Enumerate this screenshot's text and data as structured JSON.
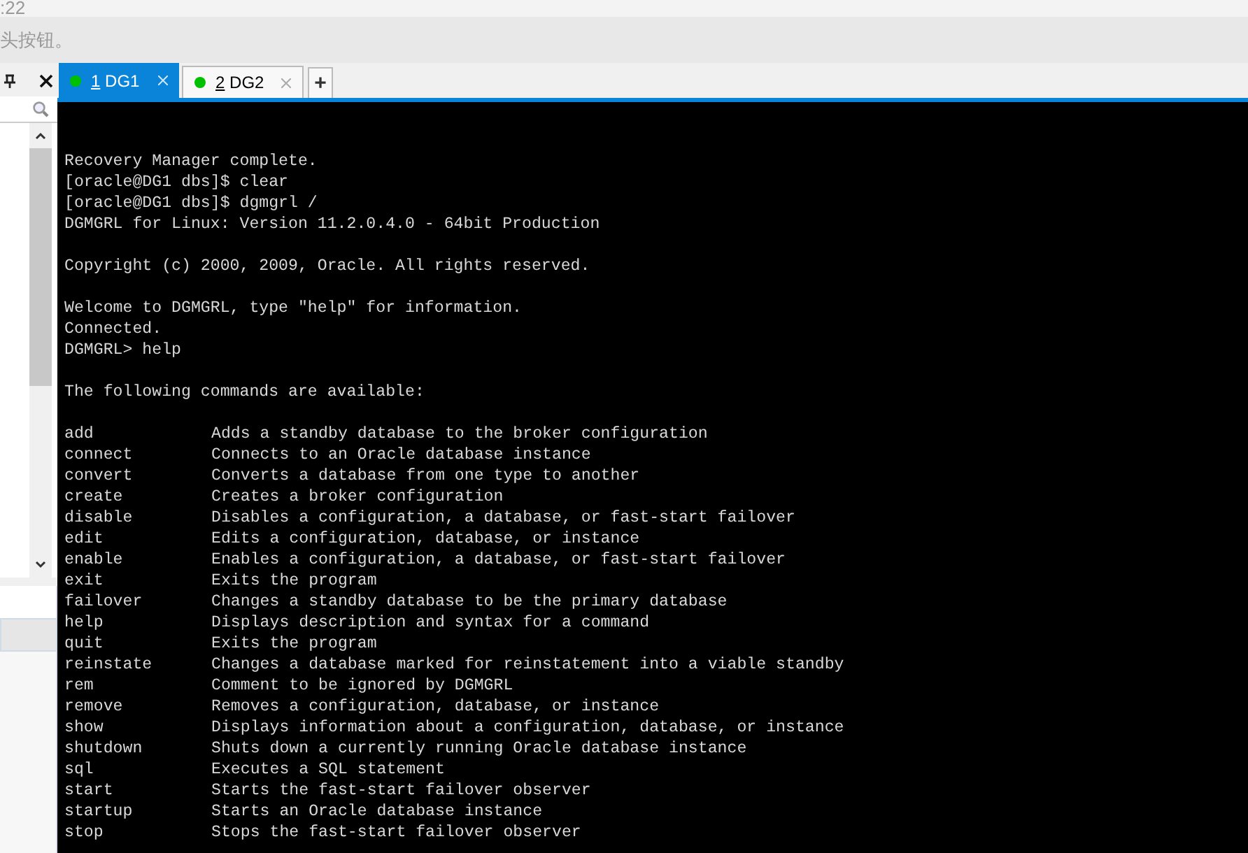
{
  "top_bar": {
    "time": ":22",
    "hint": "头按钮。"
  },
  "tabs": [
    {
      "number": "1",
      "name": "DG1",
      "selected": true,
      "color": "#00c000"
    },
    {
      "number": "2",
      "name": "DG2",
      "selected": false,
      "color": "#00c000"
    }
  ],
  "new_tab_button": "+",
  "terminal": {
    "blocks": [
      [
        "Recovery Manager complete.",
        "[oracle@DG1 dbs]$ clear",
        "[oracle@DG1 dbs]$ dgmgrl /",
        "DGMGRL for Linux: Version 11.2.0.4.0 - 64bit Production"
      ],
      [
        "Copyright (c) 2000, 2009, Oracle. All rights reserved."
      ],
      [
        "Welcome to DGMGRL, type \"help\" for information.",
        "Connected.",
        "DGMGRL> help"
      ],
      [
        "The following commands are available:"
      ]
    ],
    "commands": [
      {
        "command": "add",
        "description": "Adds a standby database to the broker configuration"
      },
      {
        "command": "connect",
        "description": "Connects to an Oracle database instance"
      },
      {
        "command": "convert",
        "description": "Converts a database from one type to another"
      },
      {
        "command": "create",
        "description": "Creates a broker configuration"
      },
      {
        "command": "disable",
        "description": "Disables a configuration, a database, or fast-start failover"
      },
      {
        "command": "edit",
        "description": "Edits a configuration, database, or instance"
      },
      {
        "command": "enable",
        "description": "Enables a configuration, a database, or fast-start failover"
      },
      {
        "command": "exit",
        "description": "Exits the program"
      },
      {
        "command": "failover",
        "description": "Changes a standby database to be the primary database"
      },
      {
        "command": "help",
        "description": "Displays description and syntax for a command"
      },
      {
        "command": "quit",
        "description": "Exits the program"
      },
      {
        "command": "reinstate",
        "description": "Changes a database marked for reinstatement into a viable standby"
      },
      {
        "command": "rem",
        "description": "Comment to be ignored by DGMGRL"
      },
      {
        "command": "remove",
        "description": "Removes a configuration, database, or instance"
      },
      {
        "command": "show",
        "description": "Displays information about a configuration, database, or instance"
      },
      {
        "command": "shutdown",
        "description": "Shuts down a currently running Oracle database instance"
      },
      {
        "command": "sql",
        "description": "Executes a SQL statement"
      },
      {
        "command": "start",
        "description": "Starts the fast-start failover observer"
      },
      {
        "command": "startup",
        "description": "Starts an Oracle database instance"
      },
      {
        "command": "stop",
        "description": "Stops the fast-start failover observer"
      }
    ]
  }
}
